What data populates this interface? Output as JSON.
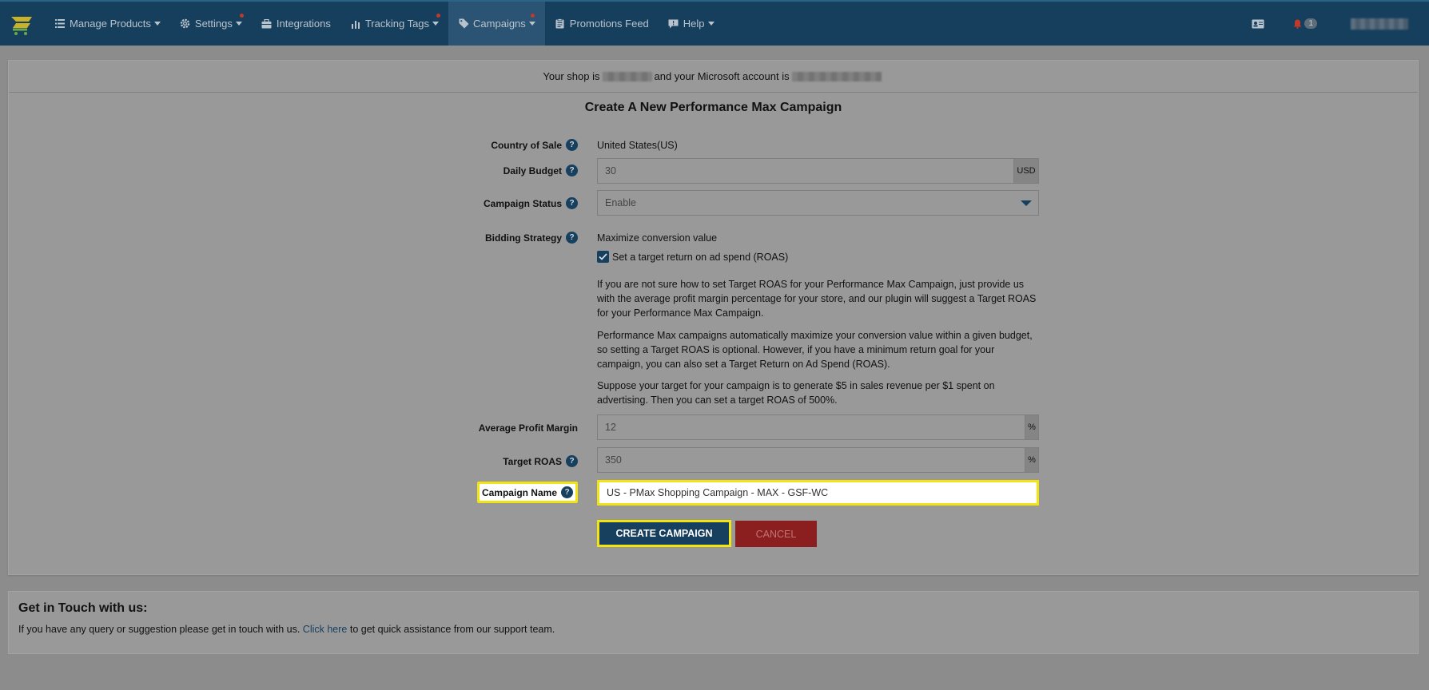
{
  "nav": {
    "items": [
      {
        "label": "Manage Products",
        "icon": "list-icon",
        "caret": true,
        "dot": false
      },
      {
        "label": "Settings",
        "icon": "gear-icon",
        "caret": true,
        "dot": true
      },
      {
        "label": "Integrations",
        "icon": "briefcase-icon",
        "caret": false,
        "dot": false
      },
      {
        "label": "Tracking Tags",
        "icon": "bar-chart-icon",
        "caret": true,
        "dot": true
      },
      {
        "label": "Campaigns",
        "icon": "tag-icon",
        "caret": true,
        "dot": true,
        "active": true
      },
      {
        "label": "Promotions Feed",
        "icon": "clipboard-icon",
        "caret": false,
        "dot": false
      },
      {
        "label": "Help",
        "icon": "comment-icon",
        "caret": true,
        "dot": false
      }
    ],
    "notification_count": "1"
  },
  "header": {
    "shop_prefix": "Your shop is",
    "account_text": "and your Microsoft account is"
  },
  "form": {
    "title": "Create A New Performance Max Campaign",
    "country_label": "Country of Sale",
    "country_value": "United States(US)",
    "budget_label": "Daily Budget",
    "budget_value": "30",
    "budget_unit": "USD",
    "status_label": "Campaign Status",
    "status_value": "Enable",
    "bidding_label": "Bidding Strategy",
    "bidding_value": "Maximize conversion value",
    "roas_checkbox_label": "Set a target return on ad spend (ROAS)",
    "roas_checked": true,
    "para1": "If you are not sure how to set Target ROAS for your Performance Max Campaign, just provide us with the average profit margin percentage for your store, and our plugin will suggest a Target ROAS for your Performance Max Campaign.",
    "para2": "Performance Max campaigns automatically maximize your conversion value within a given budget, so setting a Target ROAS is optional. However, if you have a minimum return goal for your campaign, you can also set a Target Return on Ad Spend (ROAS).",
    "para3": "Suppose your target for your campaign is to generate $5 in sales revenue per $1 spent on advertising. Then you can set a target ROAS of 500%.",
    "margin_label": "Average Profit Margin",
    "margin_value": "12",
    "margin_unit": "%",
    "target_roas_label": "Target ROAS",
    "target_roas_value": "350",
    "target_roas_unit": "%",
    "name_label": "Campaign Name",
    "name_value": "US - PMax Shopping Campaign - MAX - GSF-WC",
    "create_button": "CREATE CAMPAIGN",
    "cancel_button": "CANCEL"
  },
  "contact": {
    "title": "Get in Touch with us:",
    "text_before": "If you have any query or suggestion please get in touch with us.",
    "link": "Click here",
    "text_after": "to get quick assistance from our support team."
  },
  "colors": {
    "navbar": "#163f5e",
    "accent": "#173f5e",
    "highlight": "#f2e313",
    "cancel": "#8b1e1e"
  }
}
